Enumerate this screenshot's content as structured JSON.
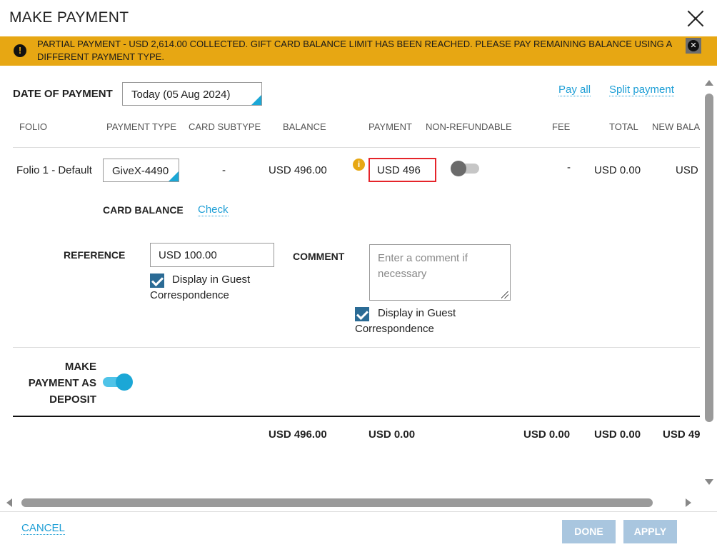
{
  "dialog": {
    "title": "MAKE PAYMENT"
  },
  "banner": {
    "icon": "exclamation-icon",
    "message": "PARTIAL PAYMENT - USD 2,614.00 COLLECTED. GIFT CARD BALANCE LIMIT HAS BEEN REACHED. PLEASE PAY REMAINING BALANCE USING A DIFFERENT PAYMENT TYPE.",
    "color": "#e7a713"
  },
  "date": {
    "label": "DATE OF PAYMENT",
    "value": "Today (05 Aug 2024)"
  },
  "links": {
    "pay_all": "Pay all",
    "split_payment": "Split payment"
  },
  "columns": [
    "FOLIO",
    "PAYMENT TYPE",
    "CARD SUBTYPE",
    "BALANCE",
    "PAYMENT",
    "NON-REFUNDABLE",
    "FEE",
    "TOTAL",
    "NEW BALA"
  ],
  "row": {
    "folio": "Folio 1 - Default",
    "payment_type": "GiveX-4490",
    "card_subtype": "-",
    "balance": "USD 496.00",
    "payment": "USD 496",
    "fee": "-",
    "total": "USD 0.00",
    "new_balance": "USD"
  },
  "card_balance": {
    "label": "CARD BALANCE",
    "link": "Check"
  },
  "reference": {
    "label": "REFERENCE",
    "value": "USD 100.00",
    "checkbox_label": "Display in Guest Correspondence"
  },
  "comment": {
    "label": "COMMENT",
    "placeholder": "Enter a comment if necessary",
    "checkbox_label": "Display in Guest Correspondence"
  },
  "deposit": {
    "label": "MAKE PAYMENT AS DEPOSIT"
  },
  "totals": {
    "balance": "USD 496.00",
    "payment": "USD 0.00",
    "fee": "USD 0.00",
    "total": "USD 0.00",
    "new_balance": "USD 49"
  },
  "footer": {
    "cancel": "CANCEL",
    "done": "DONE",
    "apply": "APPLY"
  }
}
